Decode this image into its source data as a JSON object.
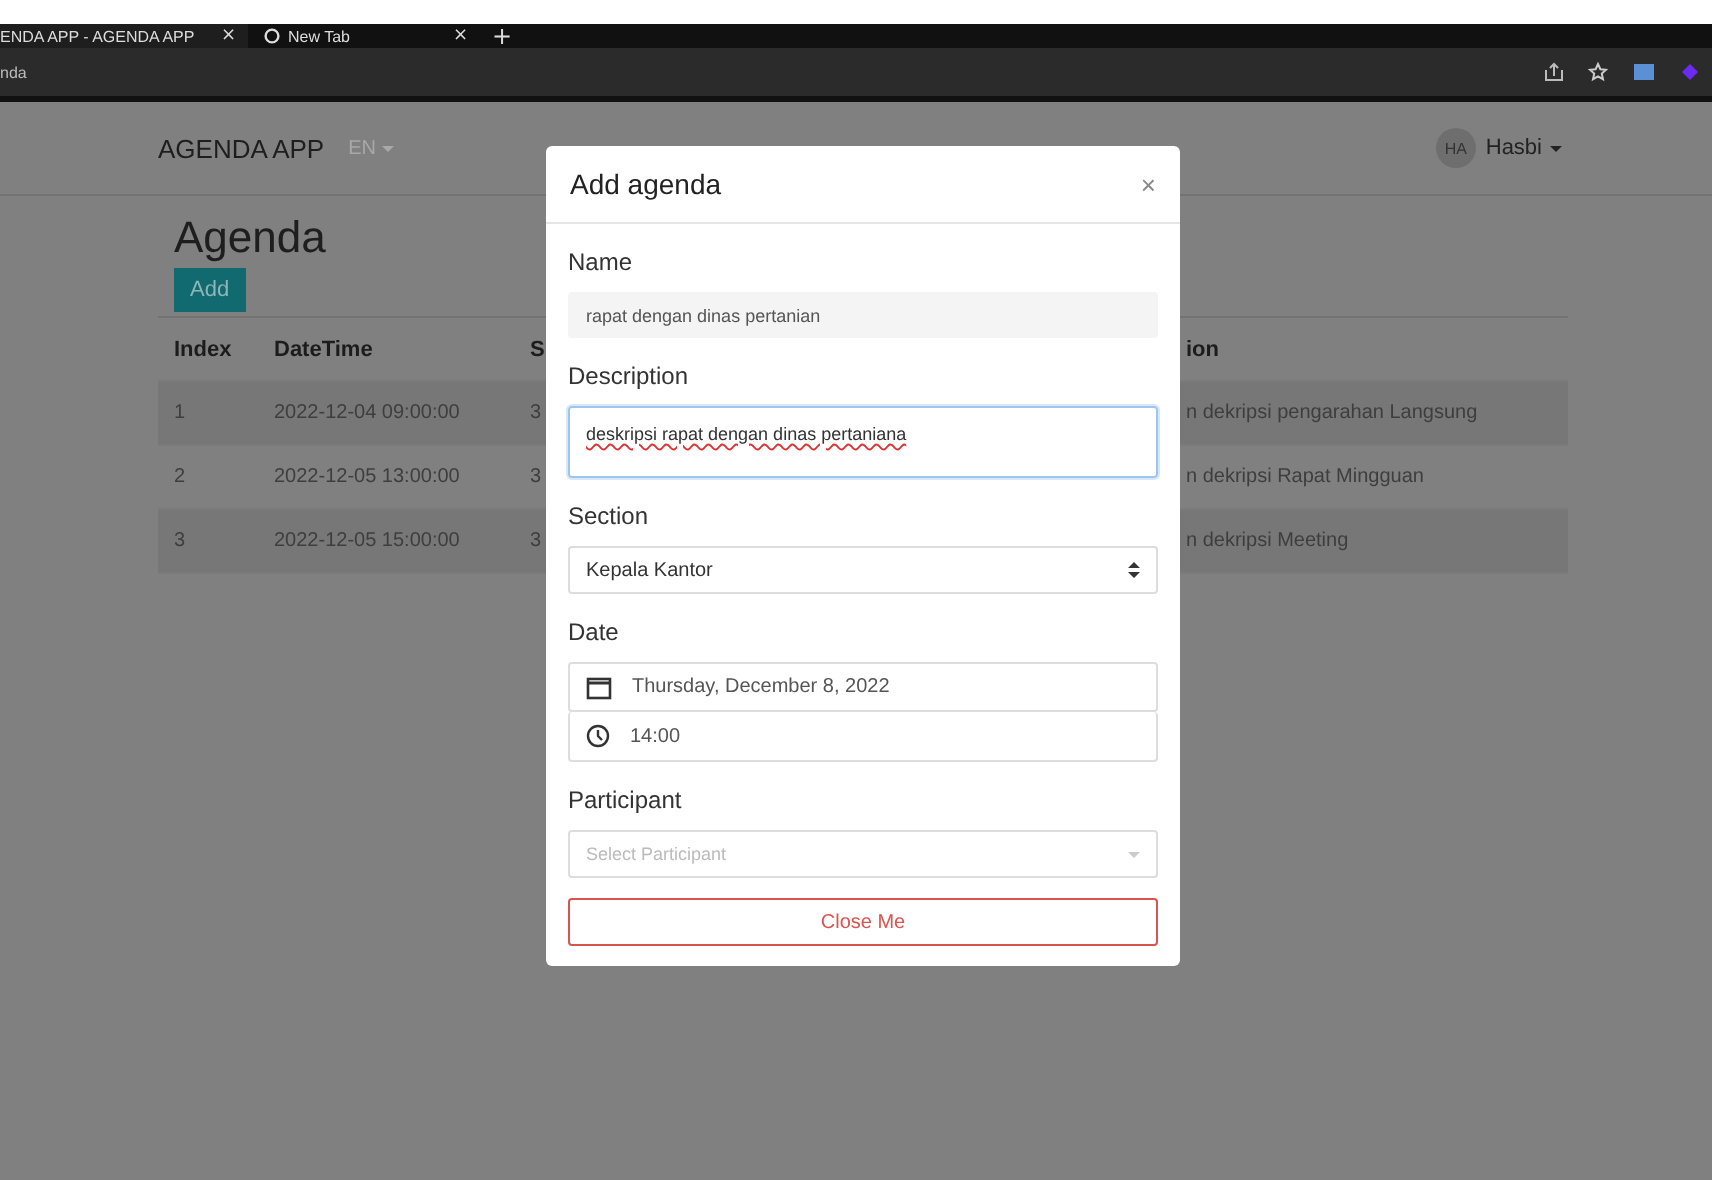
{
  "browser": {
    "tabs": [
      {
        "title": "ENDA APP - AGENDA APP",
        "close": "×",
        "selected": true
      },
      {
        "title": "New Tab",
        "close": "×",
        "selected": false
      }
    ],
    "new_tab": "+",
    "address": "nda"
  },
  "navbar": {
    "brand": "AGENDA APP",
    "language": "EN",
    "avatar": "HA",
    "user": "Hasbi"
  },
  "page": {
    "title": "Agenda",
    "add_button": "Add",
    "table": {
      "columns": [
        "Index",
        "DateTime",
        "S",
        "ion"
      ],
      "rows": [
        [
          "1",
          "2022-12-04 09:00:00",
          "3",
          "n dekripsi pengarahan Langsung"
        ],
        [
          "2",
          "2022-12-05 13:00:00",
          "3",
          "n dekripsi Rapat Mingguan"
        ],
        [
          "3",
          "2022-12-05 15:00:00",
          "3",
          "n dekripsi Meeting"
        ]
      ]
    }
  },
  "modal": {
    "title": "Add agenda",
    "close": "×",
    "name": {
      "label": "Name",
      "value": "rapat dengan dinas pertanian"
    },
    "description": {
      "label": "Description",
      "value": "deskripsi rapat dengan dinas pertaniana"
    },
    "section": {
      "label": "Section",
      "value": "Kepala Kantor"
    },
    "date": {
      "label": "Date",
      "date": "Thursday, December 8, 2022",
      "time": "14:00"
    },
    "participant": {
      "label": "Participant",
      "placeholder": "Select Participant"
    },
    "close_button": "Close Me"
  }
}
